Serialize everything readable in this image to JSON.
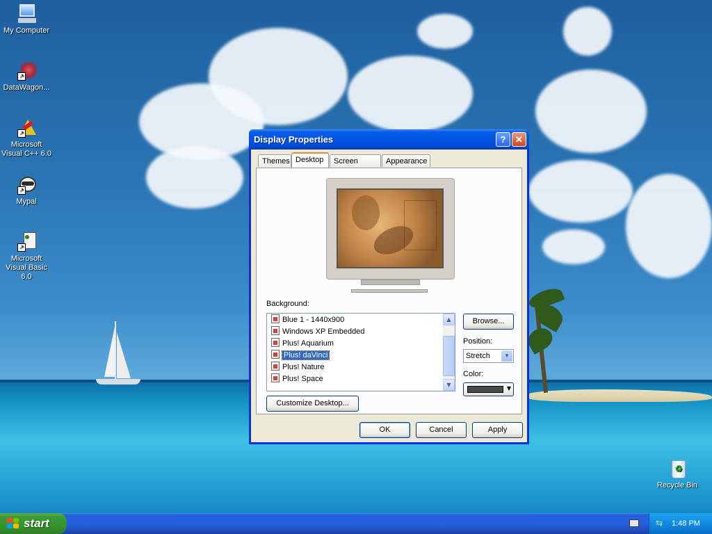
{
  "desktop": {
    "icons": [
      {
        "label": "My Computer"
      },
      {
        "label": "DataWagon..."
      },
      {
        "label": "Microsoft Visual C++ 6.0"
      },
      {
        "label": "Mypal"
      },
      {
        "label": "Microsoft Visual Basic 6.0"
      },
      {
        "label": "Recycle Bin"
      }
    ]
  },
  "dialog": {
    "title": "Display Properties",
    "help_label": "?",
    "close_label": "✕",
    "tabs": [
      {
        "label": "Themes"
      },
      {
        "label": "Desktop"
      },
      {
        "label": "Screen Saver"
      },
      {
        "label": "Appearance"
      }
    ],
    "active_tab": "Desktop",
    "background_label": "Background:",
    "backgrounds": [
      {
        "label": "Blue 1 - 1440x900"
      },
      {
        "label": "Windows XP Embedded"
      },
      {
        "label": "Plus! Aquarium"
      },
      {
        "label": "Plus! daVinci"
      },
      {
        "label": "Plus! Nature"
      },
      {
        "label": "Plus! Space"
      }
    ],
    "selected_background": "Plus! daVinci",
    "browse_label": "Browse...",
    "position_label": "Position:",
    "position_value": "Stretch",
    "color_label": "Color:",
    "color_value": "#4a4a4a",
    "customize_label": "Customize Desktop...",
    "ok_label": "OK",
    "cancel_label": "Cancel",
    "apply_label": "Apply"
  },
  "taskbar": {
    "start_label": "start",
    "clock": "1:48 PM"
  }
}
